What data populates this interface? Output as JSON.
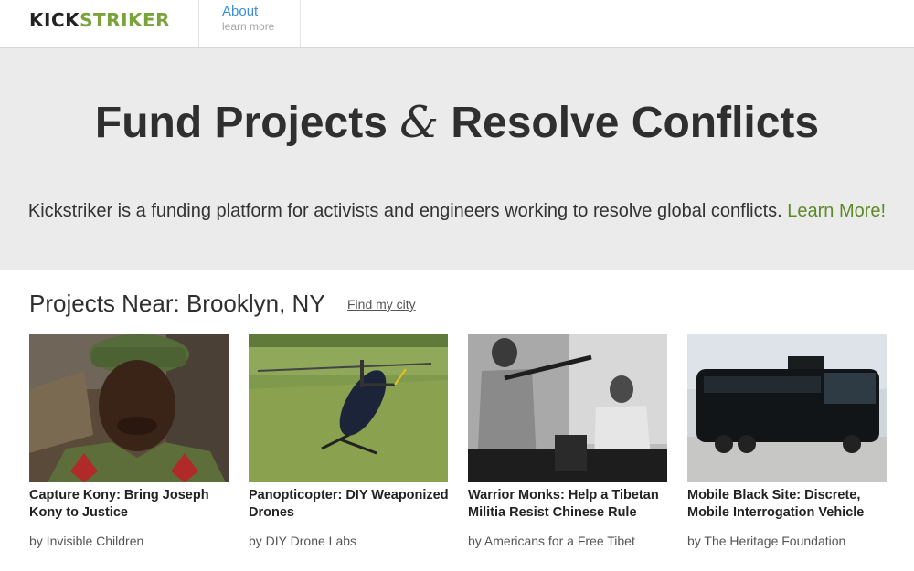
{
  "logo": {
    "part1": "KICK",
    "part2": "STRIKER"
  },
  "nav": {
    "about_title": "About",
    "about_sub": "learn more"
  },
  "hero": {
    "title_a": "Fund Projects ",
    "title_amp": "&",
    "title_b": " Resolve Conflicts",
    "subtitle": "Kickstriker is a funding platform for activists and engineers working to resolve global conflicts. ",
    "learn_more": "Learn More!"
  },
  "projects": {
    "heading": "Projects Near: Brooklyn, NY",
    "find_city": "Find my city",
    "items": [
      {
        "title": "Capture Kony: Bring Joseph Kony to Justice",
        "by": "by Invisible Children"
      },
      {
        "title": "Panopticopter: DIY Weaponized Drones",
        "by": "by DIY Drone Labs"
      },
      {
        "title": "Warrior Monks: Help a Tibetan Militia Resist Chinese Rule",
        "by": "by Americans for a Free Tibet"
      },
      {
        "title": "Mobile Black Site: Discrete, Mobile Interrogation Vehicle",
        "by": "by The Heritage Foundation"
      }
    ]
  },
  "colors": {
    "brand_dark": "#222222",
    "brand_green": "#7aa33a",
    "link_blue": "#3b8fd6",
    "learn_more_green": "#5d8a25",
    "hero_bg": "#ebebeb"
  }
}
